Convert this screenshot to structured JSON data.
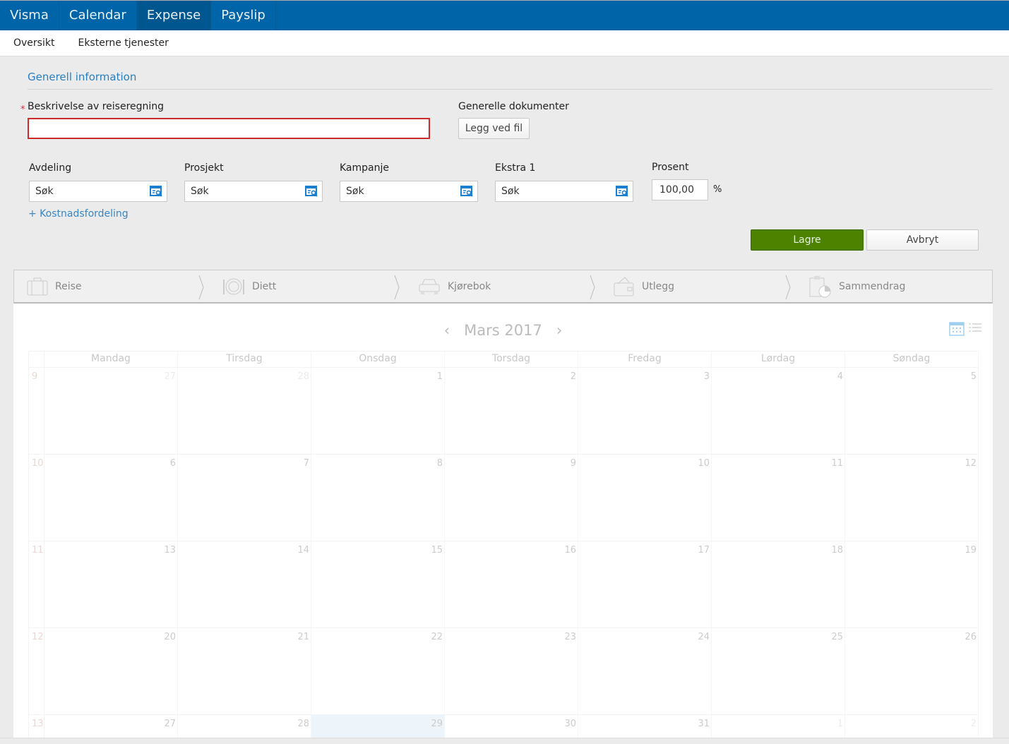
{
  "topnav": {
    "items": [
      "Visma",
      "Calendar",
      "Expense",
      "Payslip"
    ],
    "active": 2
  },
  "subnav": {
    "items": [
      "Oversikt",
      "Eksterne tjenester"
    ]
  },
  "form": {
    "section_title": "Generell information",
    "required_mark": "*",
    "description_label": "Beskrivelse av reiseregning",
    "description_value": "",
    "documents_label": "Generelle dokumenter",
    "attach_button": "Legg ved fil",
    "fields": [
      {
        "label": "Avdeling",
        "placeholder": "Søk"
      },
      {
        "label": "Prosjekt",
        "placeholder": "Søk"
      },
      {
        "label": "Kampanje",
        "placeholder": "Søk"
      },
      {
        "label": "Ekstra 1",
        "placeholder": "Søk"
      }
    ],
    "percent_label": "Prosent",
    "percent_value": "100,00",
    "percent_unit": "%",
    "cost_link": "+ Kostnadsfordeling",
    "save": "Lagre",
    "cancel": "Avbryt"
  },
  "steps": [
    {
      "label": "Reise",
      "icon": "suitcase-icon"
    },
    {
      "label": "Diett",
      "icon": "plate-icon"
    },
    {
      "label": "Kjørebok",
      "icon": "car-icon"
    },
    {
      "label": "Utlegg",
      "icon": "wallet-icon"
    },
    {
      "label": "Sammendrag",
      "icon": "summary-icon"
    }
  ],
  "calendar": {
    "month": "Mars 2017",
    "weekdays": [
      "Mandag",
      "Tirsdag",
      "Onsdag",
      "Torsdag",
      "Fredag",
      "Lørdag",
      "Søndag"
    ],
    "weeks": [
      {
        "week": "9",
        "days": [
          {
            "d": "27",
            "other": true
          },
          {
            "d": "28",
            "other": true
          },
          {
            "d": "1"
          },
          {
            "d": "2"
          },
          {
            "d": "3"
          },
          {
            "d": "4"
          },
          {
            "d": "5"
          }
        ]
      },
      {
        "week": "10",
        "days": [
          {
            "d": "6"
          },
          {
            "d": "7"
          },
          {
            "d": "8"
          },
          {
            "d": "9"
          },
          {
            "d": "10"
          },
          {
            "d": "11"
          },
          {
            "d": "12"
          }
        ]
      },
      {
        "week": "11",
        "days": [
          {
            "d": "13"
          },
          {
            "d": "14"
          },
          {
            "d": "15"
          },
          {
            "d": "16"
          },
          {
            "d": "17"
          },
          {
            "d": "18"
          },
          {
            "d": "19"
          }
        ]
      },
      {
        "week": "12",
        "days": [
          {
            "d": "20"
          },
          {
            "d": "21"
          },
          {
            "d": "22"
          },
          {
            "d": "23"
          },
          {
            "d": "24"
          },
          {
            "d": "25"
          },
          {
            "d": "26"
          }
        ]
      },
      {
        "week": "13",
        "days": [
          {
            "d": "27"
          },
          {
            "d": "28"
          },
          {
            "d": "29",
            "today": true
          },
          {
            "d": "30"
          },
          {
            "d": "31"
          },
          {
            "d": "1",
            "other": true
          },
          {
            "d": "2",
            "other": true
          }
        ]
      }
    ]
  },
  "colors": {
    "nav": "#0065a8",
    "save": "#4c8200",
    "error": "#cc2a2a",
    "link": "#3a86c4"
  }
}
